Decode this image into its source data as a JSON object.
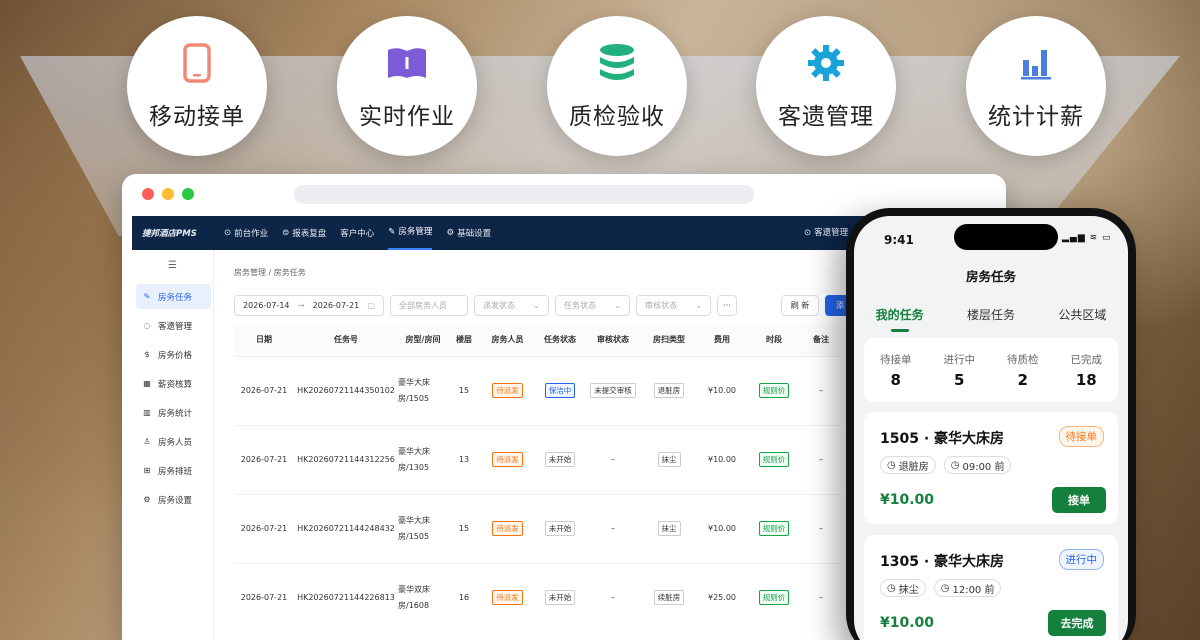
{
  "features": [
    {
      "label": "移动接单",
      "icon": "phone-icon"
    },
    {
      "label": "实时作业",
      "icon": "book-icon"
    },
    {
      "label": "质检验收",
      "icon": "database-icon"
    },
    {
      "label": "客遗管理",
      "icon": "gear-icon"
    },
    {
      "label": "统计计薪",
      "icon": "bar-chart-icon"
    }
  ],
  "pms": {
    "logo": "捷邦酒店PMS",
    "nav": [
      "前台作业",
      "报表复盘",
      "客户中心",
      "房务管理",
      "基础设置"
    ],
    "nav_active": "房务管理",
    "nav_right": "客遗管理",
    "sidebar": [
      "房务任务",
      "客遗管理",
      "房务价格",
      "薪资核算",
      "房务统计",
      "房务人员",
      "房务排班",
      "房务设置"
    ],
    "breadcrumb": "房务管理 / 房务任务",
    "filters": {
      "date_from": "2026-07-14",
      "date_arrow": "→",
      "date_to": "2026-07-21",
      "staff": "全部房务人员",
      "dispatch": "派发状态",
      "task": "任务状态",
      "audit": "审核状态",
      "more": "···",
      "refresh": "刷 新",
      "add": "添"
    },
    "columns": [
      "日期",
      "任务号",
      "房型/房间",
      "楼层",
      "房务人员",
      "任务状态",
      "审核状态",
      "房扫类型",
      "费用",
      "时段",
      "备注"
    ],
    "rows": [
      {
        "date": "2026-07-21",
        "task_no": "HK20260721144350102",
        "room_type": "豪华大床",
        "room": "房/1505",
        "floor": "15",
        "staff": "待派发",
        "status": "保洁中",
        "audit": "未提交审核",
        "clean": "退脏房",
        "fee": "¥10.00",
        "period": "规则价",
        "note": "–"
      },
      {
        "date": "2026-07-21",
        "task_no": "HK20260721144312256",
        "room_type": "豪华大床",
        "room": "房/1305",
        "floor": "13",
        "staff": "待派发",
        "status": "未开始",
        "audit": "–",
        "clean": "抹尘",
        "fee": "¥10.00",
        "period": "规则价",
        "note": "–"
      },
      {
        "date": "2026-07-21",
        "task_no": "HK20260721144248432",
        "room_type": "豪华大床",
        "room": "房/1505",
        "floor": "15",
        "staff": "待派发",
        "status": "未开始",
        "audit": "–",
        "clean": "抹尘",
        "fee": "¥10.00",
        "period": "规则价",
        "note": "–"
      },
      {
        "date": "2026-07-21",
        "task_no": "HK20260721144226813",
        "room_type": "豪华双床",
        "room": "房/1608",
        "floor": "16",
        "staff": "待派发",
        "status": "未开始",
        "audit": "–",
        "clean": "续脏房",
        "fee": "¥25.00",
        "period": "规则价",
        "note": "–"
      }
    ]
  },
  "phone": {
    "time": "9:41",
    "status": "▂▄▆ ≋ ▭",
    "title": "房务任务",
    "tabs": [
      "我的任务",
      "楼层任务",
      "公共区域"
    ],
    "stats": [
      {
        "k": "待接单",
        "v": "8"
      },
      {
        "k": "进行中",
        "v": "5"
      },
      {
        "k": "待质检",
        "v": "2"
      },
      {
        "k": "已完成",
        "v": "18"
      }
    ],
    "cards": [
      {
        "room": "1505 · 豪华大床房",
        "status": "待接单",
        "chips": [
          "退脏房",
          "09:00 前"
        ],
        "price": "¥10.00",
        "action": "接单"
      },
      {
        "room": "1305 · 豪华大床房",
        "status": "进行中",
        "chips": [
          "抹尘",
          "12:00 前"
        ],
        "price": "¥10.00",
        "action": "去完成"
      }
    ]
  },
  "colors": {
    "nav": "#0d2547",
    "accent": "#2563eb",
    "green": "#15803d",
    "orange": "#f97316"
  }
}
